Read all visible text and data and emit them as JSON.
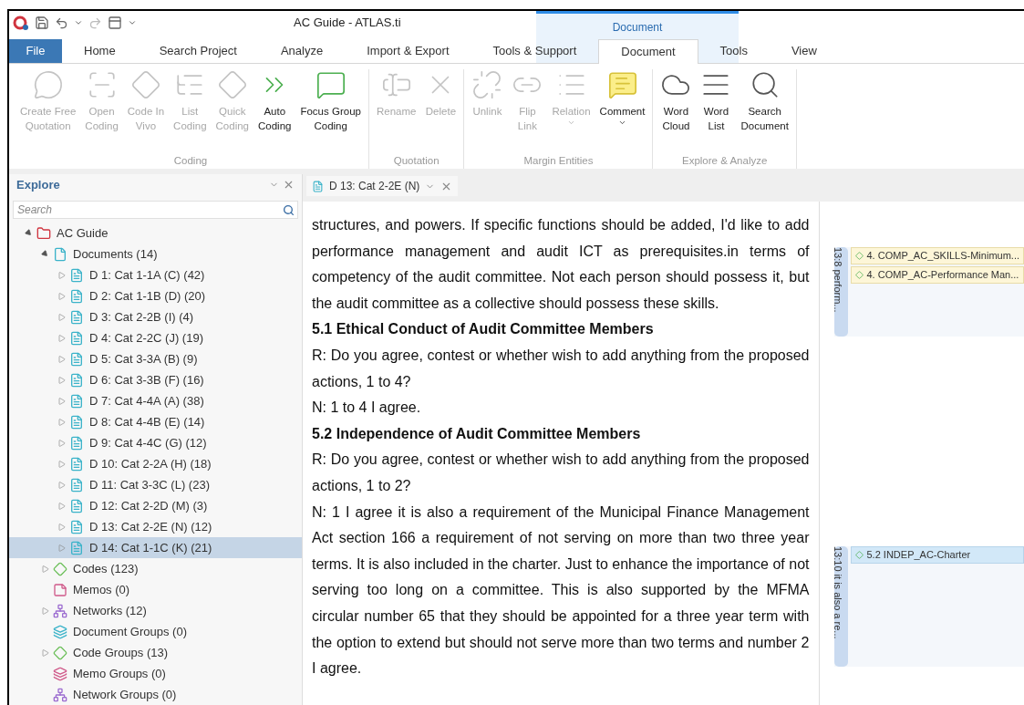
{
  "window": {
    "title": "AC Guide - ATLAS.ti",
    "context_label": "Document"
  },
  "ribbon_tabs": [
    {
      "label": "File",
      "kind": "file",
      "selected": false
    },
    {
      "label": "Home",
      "kind": "tab",
      "selected": false
    },
    {
      "label": "Search Project",
      "kind": "tab",
      "selected": false
    },
    {
      "label": "Analyze",
      "kind": "tab",
      "selected": false
    },
    {
      "label": "Import & Export",
      "kind": "tab",
      "selected": false
    },
    {
      "label": "Tools & Support",
      "kind": "tab",
      "selected": false
    },
    {
      "label": "Document",
      "kind": "tab",
      "selected": true
    },
    {
      "label": "Tools",
      "kind": "tab",
      "selected": false
    },
    {
      "label": "View",
      "kind": "tab",
      "selected": false
    }
  ],
  "ribbon_groups": [
    {
      "label": "Coding",
      "buttons": [
        {
          "lines": [
            "Create Free",
            "Quotation"
          ],
          "disabled": true
        },
        {
          "lines": [
            "Open",
            "Coding"
          ],
          "disabled": true
        },
        {
          "lines": [
            "Code In",
            "Vivo"
          ],
          "disabled": true
        },
        {
          "lines": [
            "List",
            "Coding"
          ],
          "disabled": true
        },
        {
          "lines": [
            "Quick",
            "Coding"
          ],
          "disabled": true
        },
        {
          "lines": [
            "Auto",
            "Coding"
          ],
          "disabled": false
        },
        {
          "lines": [
            "Focus Group",
            "Coding"
          ],
          "disabled": false
        }
      ]
    },
    {
      "label": "Quotation",
      "buttons": [
        {
          "lines": [
            "Rename"
          ],
          "disabled": true
        },
        {
          "lines": [
            "Delete"
          ],
          "disabled": true
        }
      ]
    },
    {
      "label": "Margin Entities",
      "buttons": [
        {
          "lines": [
            "Unlink"
          ],
          "disabled": true
        },
        {
          "lines": [
            "Flip",
            "Link"
          ],
          "disabled": true
        },
        {
          "lines": [
            "Relation"
          ],
          "disabled": true,
          "dropdown": true
        },
        {
          "lines": [
            "Comment"
          ],
          "disabled": false,
          "dropdown": true
        }
      ]
    },
    {
      "label": "Explore & Analyze",
      "buttons": [
        {
          "lines": [
            "Word",
            "Cloud"
          ],
          "disabled": false
        },
        {
          "lines": [
            "Word",
            "List"
          ],
          "disabled": false
        },
        {
          "lines": [
            "Search",
            "Document"
          ],
          "disabled": false
        }
      ]
    }
  ],
  "explore": {
    "title": "Explore",
    "search": {
      "placeholder": "Search"
    },
    "tree": [
      {
        "label": "AC Guide",
        "kind": "project",
        "expanded": true,
        "selected": false,
        "children": [
          {
            "label": "Documents (14)",
            "kind": "folder",
            "expanded": true,
            "selected": false,
            "children": [
              {
                "label": "D 1: Cat 1-1A (C) (42)",
                "kind": "document",
                "expanded": false,
                "selected": false
              },
              {
                "label": "D 2: Cat 1-1B (D) (20)",
                "kind": "document",
                "expanded": false,
                "selected": false
              },
              {
                "label": "D 3: Cat 2-2B (I) (4)",
                "kind": "document",
                "expanded": false,
                "selected": false
              },
              {
                "label": "D 4: Cat 2-2C (J) (19)",
                "kind": "document",
                "expanded": false,
                "selected": false
              },
              {
                "label": "D 5: Cat 3-3A (B) (9)",
                "kind": "document",
                "expanded": false,
                "selected": false
              },
              {
                "label": "D 6: Cat 3-3B (F) (16)",
                "kind": "document",
                "expanded": false,
                "selected": false
              },
              {
                "label": "D 7: Cat 4-4A (A) (38)",
                "kind": "document",
                "expanded": false,
                "selected": false
              },
              {
                "label": "D 8: Cat 4-4B (E) (14)",
                "kind": "document",
                "expanded": false,
                "selected": false
              },
              {
                "label": "D 9: Cat 4-4C (G) (12)",
                "kind": "document",
                "expanded": false,
                "selected": false
              },
              {
                "label": "D 10: Cat 2-2A (H) (18)",
                "kind": "document",
                "expanded": false,
                "selected": false
              },
              {
                "label": "D 11: Cat 3-3C (L) (23)",
                "kind": "document",
                "expanded": false,
                "selected": false
              },
              {
                "label": "D 12: Cat 2-2D (M) (3)",
                "kind": "document",
                "expanded": false,
                "selected": false
              },
              {
                "label": "D 13: Cat 2-2E (N) (12)",
                "kind": "document",
                "expanded": false,
                "selected": false
              },
              {
                "label": "D 14: Cat 1-1C (K) (21)",
                "kind": "document",
                "expanded": false,
                "selected": true
              }
            ]
          },
          {
            "label": "Codes (123)",
            "kind": "codes",
            "expanded": false,
            "selected": false
          },
          {
            "label": "Memos (0)",
            "kind": "memos",
            "selected": false
          },
          {
            "label": "Networks (12)",
            "kind": "networks",
            "expanded": false,
            "selected": false
          },
          {
            "label": "Document Groups (0)",
            "kind": "document-groups",
            "selected": false
          },
          {
            "label": "Code Groups (13)",
            "kind": "code-groups",
            "expanded": false,
            "selected": false
          },
          {
            "label": "Memo Groups (0)",
            "kind": "memo-groups",
            "selected": false
          },
          {
            "label": "Network Groups (0)",
            "kind": "network-groups",
            "selected": false
          }
        ]
      }
    ]
  },
  "document_tab": {
    "label": "D 13: Cat 2-2E (N)"
  },
  "document": [
    {
      "kind": "text",
      "text": "structures, and powers.  If specific functions should be added, I'd like to add performance management and audit ICT as prerequisites.in terms of competency of the audit committee.  Not each person should possess it, but the audit committee as a collective should possess these skills."
    },
    {
      "kind": "heading",
      "text": "5.1 Ethical Conduct of Audit Committee Members"
    },
    {
      "kind": "text",
      "text": "R: Do you agree, contest or whether wish to add anything from the proposed actions, 1 to 4?"
    },
    {
      "kind": "text",
      "text": "N: 1 to 4 I agree."
    },
    {
      "kind": "heading",
      "text": "5.2 Independence of Audit Committee Members"
    },
    {
      "kind": "text",
      "text": "R: Do you agree, contest or whether wish to add anything from the proposed actions, 1 to 2?"
    },
    {
      "kind": "text",
      "text": "N: 1 I agree it is also a requirement of the Municipal Finance Management Act section 166 a requirement of not serving on more than two three year terms.  It is also included in the charter. Just to enhance the importance of not serving too long on a committee.  This is also supported by the MFMA circular number 65 that they should be appointed for a three year term with the option to extend but should not serve more than two terms and number 2 I agree."
    }
  ],
  "margin": [
    {
      "label": "13:8 perform...",
      "codes": [
        {
          "label": "4. COMP_AC_SKILLS-Minimum...",
          "selected": false
        },
        {
          "label": "4. COMP_AC-Performance Man...",
          "selected": false
        }
      ]
    },
    {
      "label": "13:10 it is also a re...",
      "codes": [
        {
          "label": "5.2 INDEP_AC-Charter",
          "selected": true
        }
      ]
    }
  ]
}
